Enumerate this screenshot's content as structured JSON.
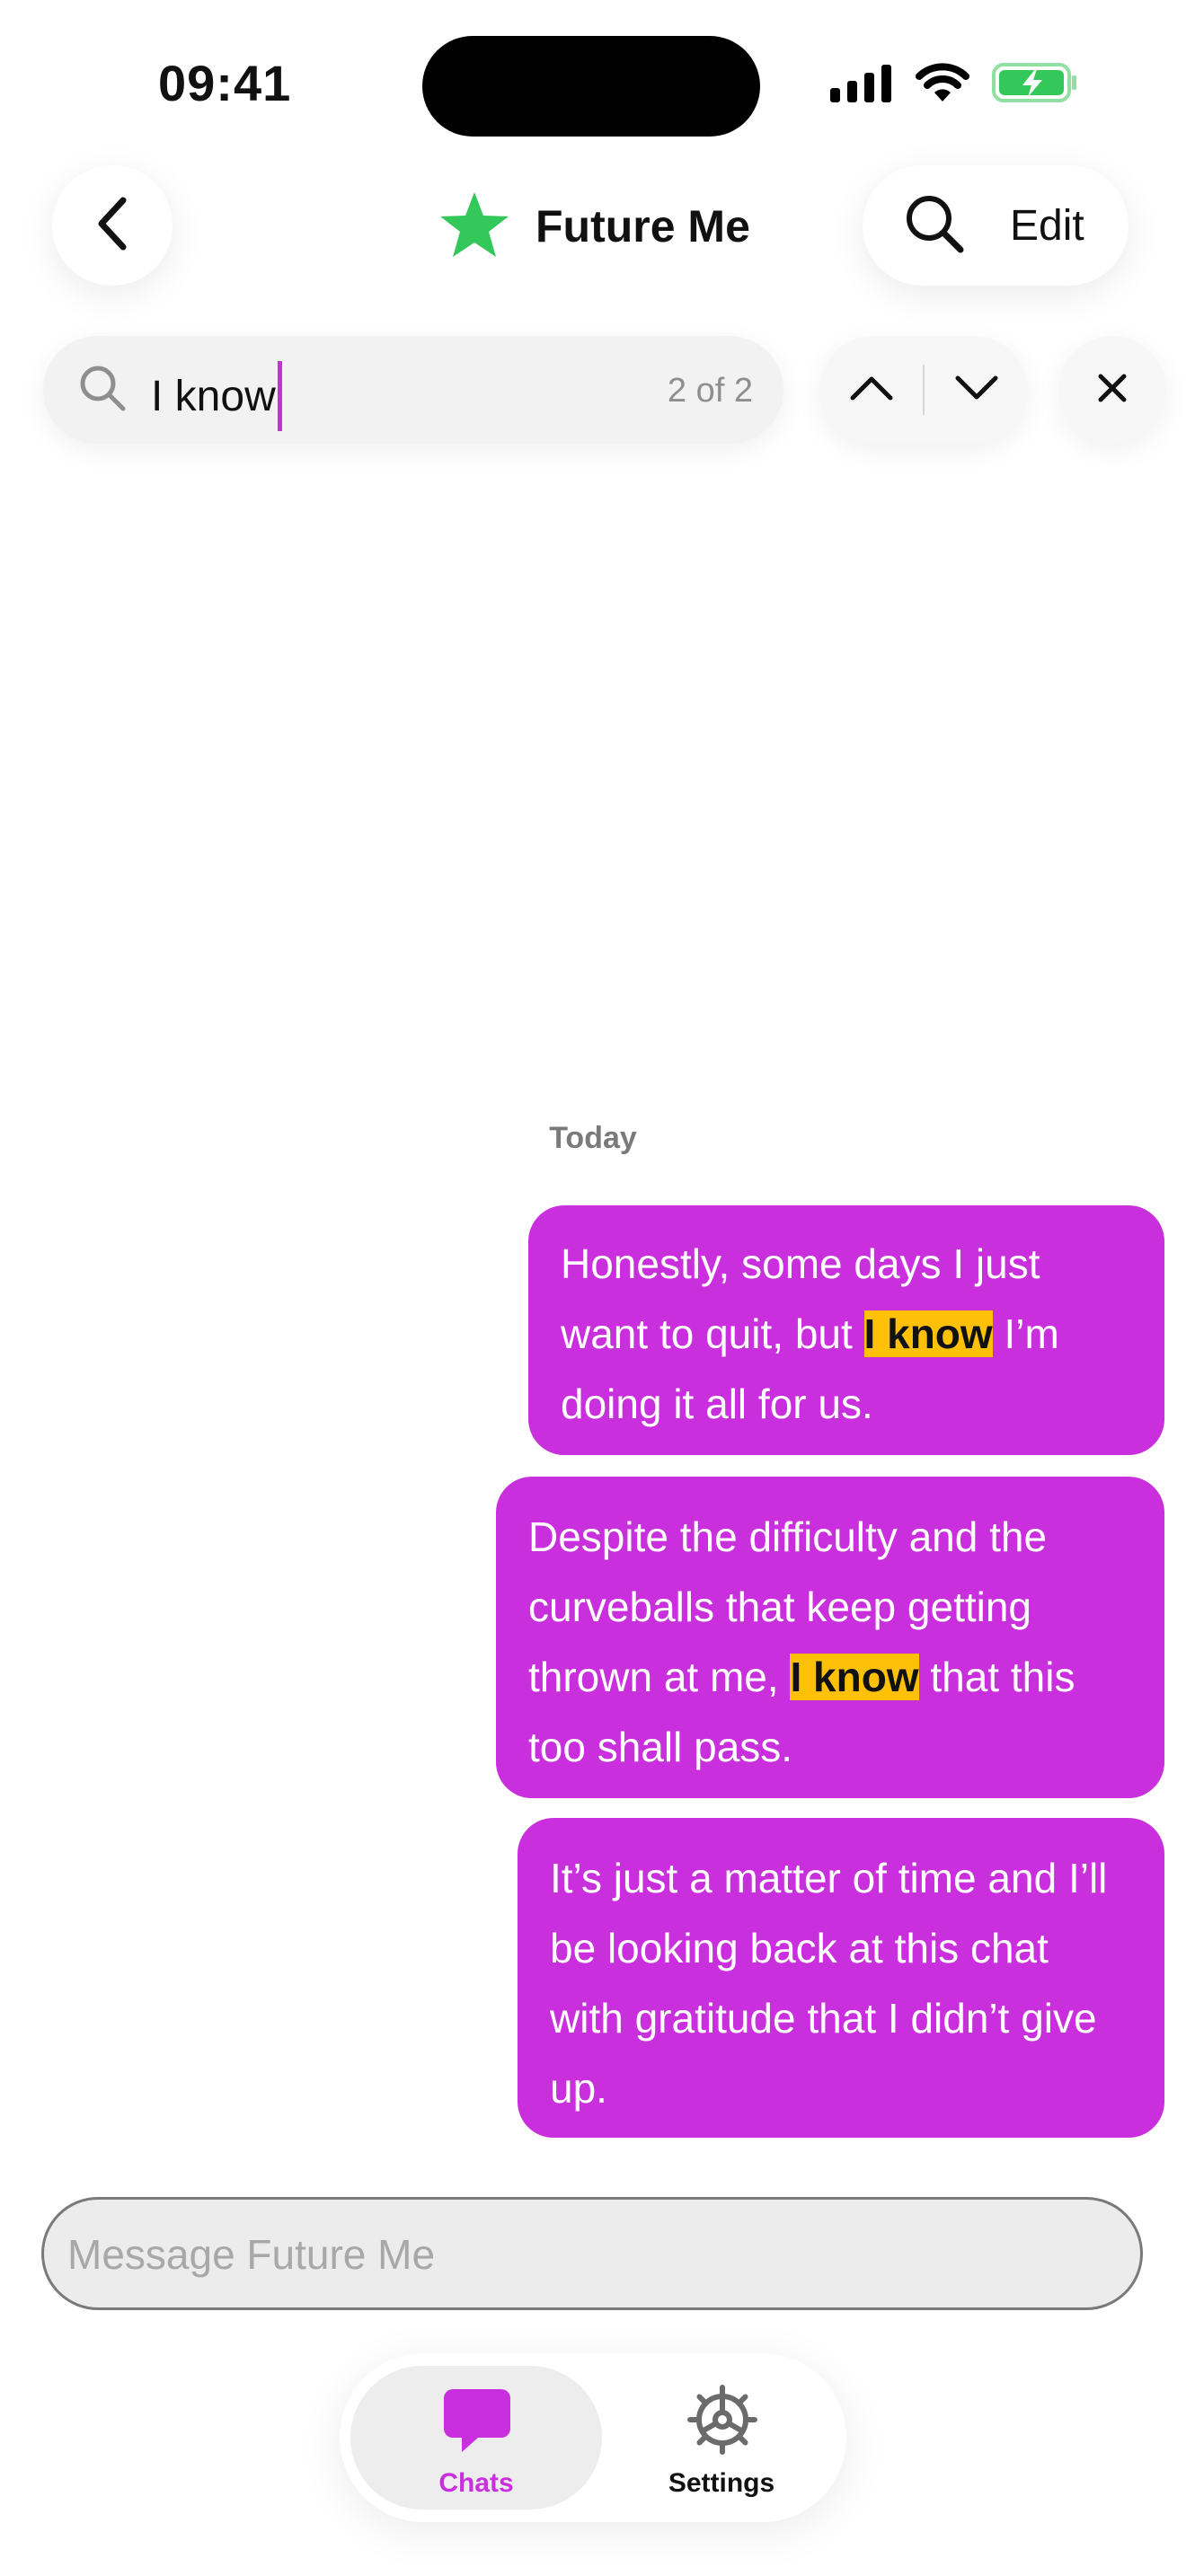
{
  "status_bar": {
    "time": "09:41",
    "icons": [
      "cellular-signal-icon",
      "wifi-icon",
      "battery-charging-icon"
    ],
    "battery_color": "#34c759"
  },
  "header": {
    "back_icon": "chevron-left-icon",
    "title": "Future Me",
    "title_icon": "star-icon",
    "title_icon_color": "#34c759",
    "search_icon": "search-icon",
    "edit_label": "Edit"
  },
  "search": {
    "query": "I know",
    "match_count": "2 of 2",
    "prev_icon": "chevron-up-icon",
    "next_icon": "chevron-down-icon",
    "close_icon": "close-icon"
  },
  "chat": {
    "day_label": "Today",
    "accent_color": "#c92fdc",
    "highlight_color": "#ffc107",
    "messages": [
      {
        "before": "Honestly, some days I just want to quit, but ",
        "highlight": "I know",
        "after": " I’m doing it all for us."
      },
      {
        "before": "Despite the difficulty and the curveballs that keep getting thrown at me, ",
        "highlight": "I know",
        "after": " that this too shall pass."
      },
      {
        "text": "It’s just a matter of time and I’ll be looking back at this chat with gratitude that I didn’t give up."
      }
    ]
  },
  "composer": {
    "placeholder": "Message Future Me"
  },
  "tabbar": {
    "tabs": [
      {
        "label": "Chats",
        "icon": "chat-bubble-icon",
        "selected": true
      },
      {
        "label": "Settings",
        "icon": "gear-icon",
        "selected": false
      }
    ]
  }
}
